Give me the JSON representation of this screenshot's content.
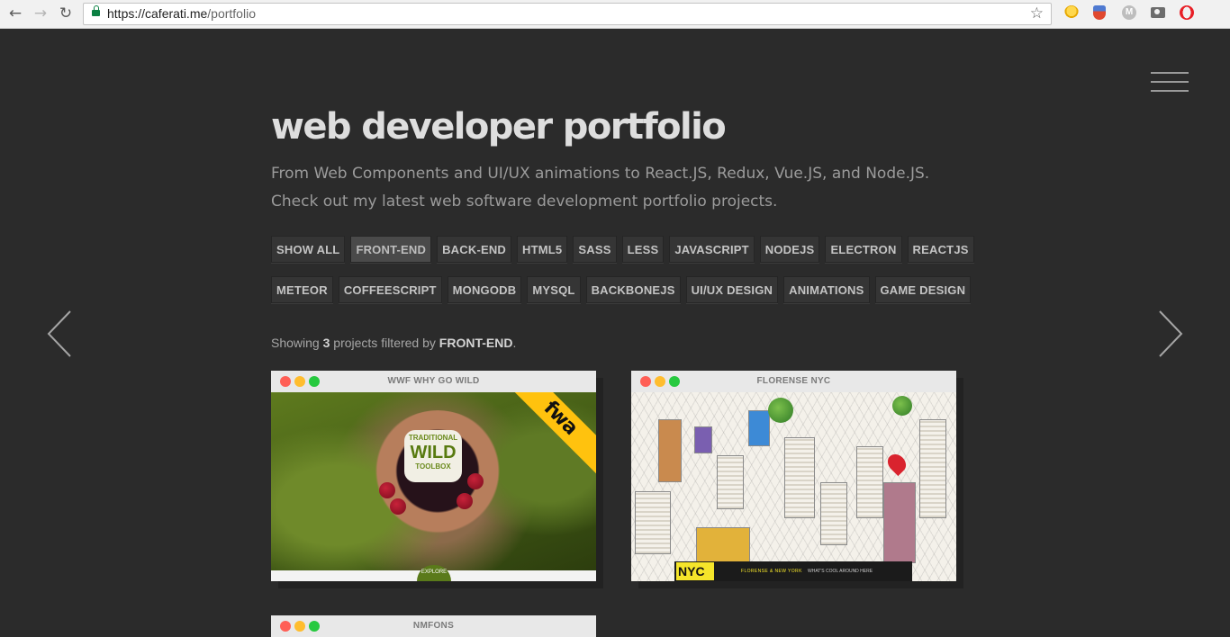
{
  "browser": {
    "url_host": "https://caferati.me",
    "url_path": "/portfolio",
    "back_glyph": "←",
    "forward_glyph": "→",
    "reload_glyph": "↻",
    "star_glyph": "☆",
    "extensions": [
      "bulb-icon",
      "shield-icon",
      "m-icon",
      "camera-icon",
      "opera-icon"
    ]
  },
  "page": {
    "title": "web developer portfolio",
    "intro": "From Web Components and UI/UX animations to React.JS, Redux, Vue.JS, and Node.JS. Check out my latest web software development portfolio projects.",
    "filters_row1": [
      "SHOW ALL",
      "FRONT-END",
      "BACK-END",
      "HTML5",
      "SASS",
      "LESS",
      "JAVASCRIPT",
      "NODEJS",
      "ELECTRON",
      "REACTJS"
    ],
    "filters_row2": [
      "METEOR",
      "COFFEESCRIPT",
      "MONGODB",
      "MYSQL",
      "BACKBONEJS",
      "UI/UX DESIGN",
      "ANIMATIONS",
      "GAME DESIGN"
    ],
    "active_filter": "FRONT-END",
    "summary": {
      "prefix": "Showing ",
      "count": "3",
      "middle": " projects filtered by ",
      "filter": "FRONT-END",
      "suffix": "."
    }
  },
  "projects": [
    {
      "title": "WWF WHY GO WILD",
      "logo_line1": "TRADITIONAL",
      "logo_line2": "WILD",
      "logo_line3": "TOOLBOX",
      "ribbon": "fwa",
      "footer_button": "EXPLORE"
    },
    {
      "title": "FLORENSE NYC",
      "logo": "NYC",
      "nav1": "FLORENSE & NEW YORK",
      "nav2": "WHAT'S COOL AROUND HERE"
    },
    {
      "title": "NMFONS"
    }
  ],
  "colors": {
    "background": "#2b2b2b",
    "filter_active": "#4a4a4a",
    "ribbon": "#ffc20e"
  }
}
